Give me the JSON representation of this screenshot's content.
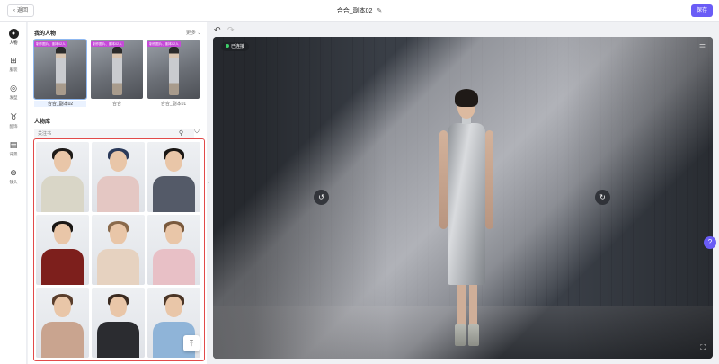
{
  "header": {
    "back_label": "返回",
    "title": "合合_副本02",
    "save_label": "保存"
  },
  "nav": {
    "items": [
      {
        "label": "人物",
        "icon": "person-icon",
        "active": true
      },
      {
        "label": "服装",
        "icon": "clothing-icon"
      },
      {
        "label": "发型",
        "icon": "hairstyle-icon"
      },
      {
        "label": "配饰",
        "icon": "accessory-icon"
      },
      {
        "label": "背景",
        "icon": "background-icon"
      },
      {
        "label": "镜头",
        "icon": "camera-icon"
      }
    ]
  },
  "my_characters": {
    "title": "我的人物",
    "more_label": "更多",
    "items": [
      {
        "name": "合合_副本02",
        "tag": "制作图片、副本02人",
        "selected": true
      },
      {
        "name": "合合",
        "tag": "制作图片、副本02人"
      },
      {
        "name": "合合_副本01",
        "tag": "制作图片、副本02人"
      }
    ]
  },
  "library": {
    "title": "人物库",
    "search_placeholder": "关注书"
  },
  "stage": {
    "status_label": "已连接"
  },
  "colors": {
    "accent": "#6a5cf6",
    "selection_border": "#e24a4a",
    "tag_bg": "#c54ad8",
    "connected_dot": "#3ed06a"
  }
}
